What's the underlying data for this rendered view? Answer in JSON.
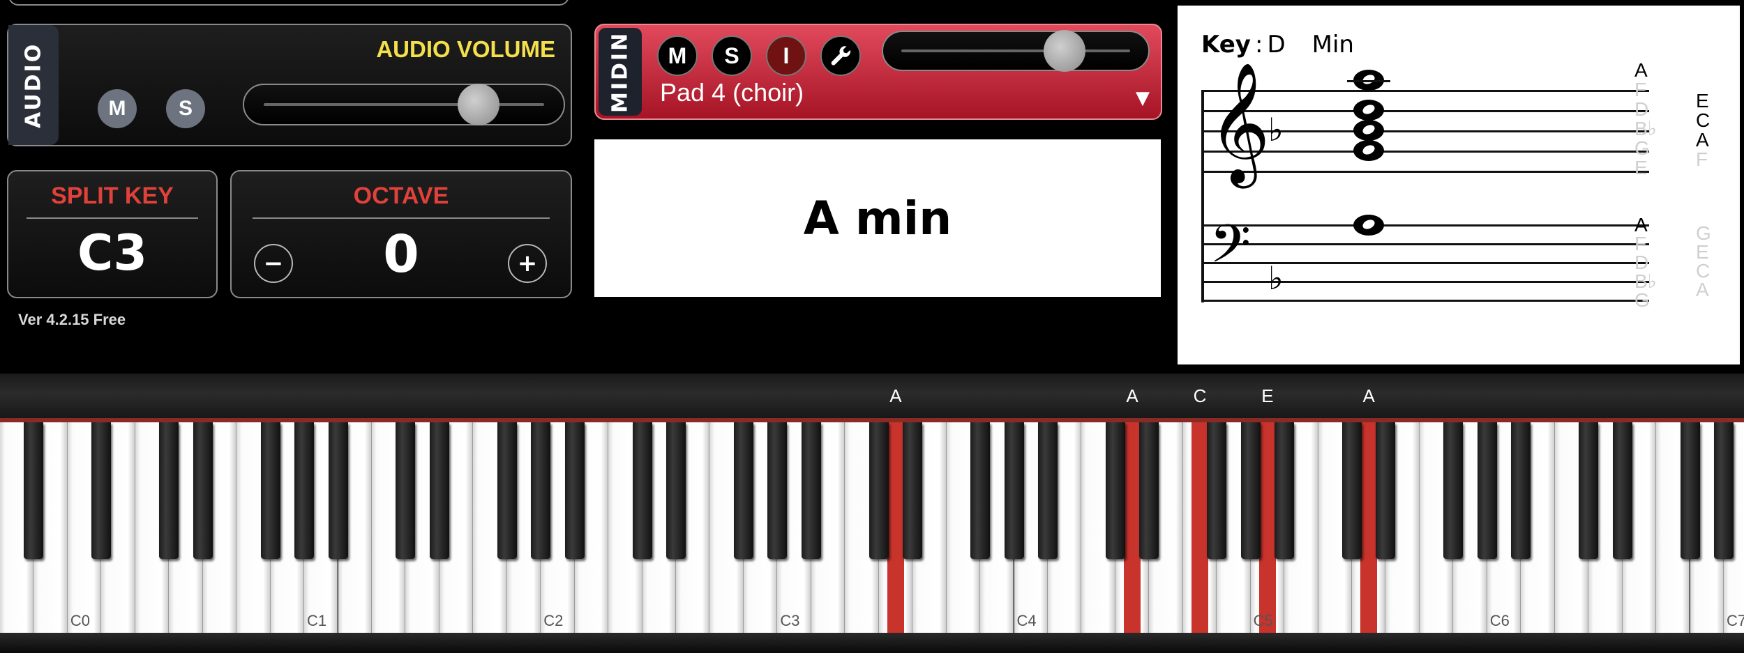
{
  "audio": {
    "side_label": "AUDIO",
    "title": "AUDIO VOLUME",
    "mute": "M",
    "solo": "S",
    "volume_fraction": 0.77,
    "title_color": "#f3e04a"
  },
  "midi": {
    "side_label": "MIDIN",
    "mute": "M",
    "solo": "S",
    "instrument_btn": "I",
    "instrument": "Pad 4 (choir)",
    "dropdown": "▼",
    "volume_fraction": 0.72
  },
  "split_key": {
    "title": "SPLIT KEY",
    "value": "C3"
  },
  "octave": {
    "title": "OCTAVE",
    "value": "0",
    "minus": "−",
    "plus": "+"
  },
  "version": "Ver 4.2.15 Free",
  "chord": "A min",
  "staff": {
    "key_label": "Key",
    "key_sep": ":",
    "key_value": "D",
    "key_mode": "Min",
    "treble_col1": [
      {
        "t": "A",
        "s": "dark"
      },
      {
        "t": "F",
        "s": "lite"
      },
      {
        "t": "D",
        "s": "lite"
      },
      {
        "t": "B♭",
        "s": "lite"
      },
      {
        "t": "G",
        "s": "lite"
      },
      {
        "t": "E",
        "s": "lite"
      }
    ],
    "treble_col2": [
      {
        "t": "E",
        "s": "dark"
      },
      {
        "t": "C",
        "s": "dark"
      },
      {
        "t": "A",
        "s": "dark"
      },
      {
        "t": "F",
        "s": "lite"
      }
    ],
    "bass_col1": [
      {
        "t": "A",
        "s": "dark"
      },
      {
        "t": "F",
        "s": "lite"
      },
      {
        "t": "D",
        "s": "lite"
      },
      {
        "t": "B♭",
        "s": "lite"
      },
      {
        "t": "G",
        "s": "lite"
      }
    ],
    "bass_col2": [
      {
        "t": "G",
        "s": "lite"
      },
      {
        "t": "E",
        "s": "lite"
      },
      {
        "t": "C",
        "s": "lite"
      },
      {
        "t": "A",
        "s": "lite"
      }
    ]
  },
  "keyboard": {
    "octave_labels": [
      "C0",
      "C1",
      "C2",
      "C3",
      "C4",
      "C5",
      "C6",
      "C7"
    ],
    "active_key_names": [
      "A",
      "A",
      "C",
      "E",
      "A"
    ],
    "pressed_white_keys": [
      26,
      33,
      35,
      37,
      40
    ],
    "highlight_color": "#c8332c"
  }
}
